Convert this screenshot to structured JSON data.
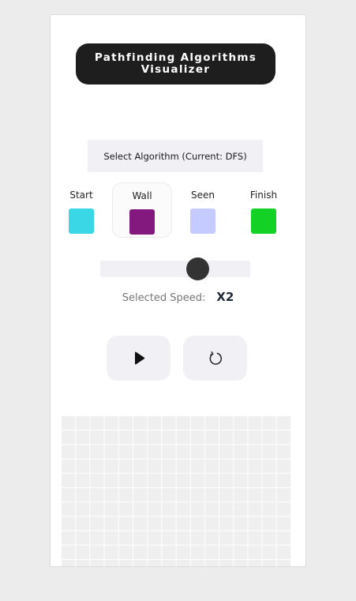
{
  "header": {
    "title_line1": "Pathfinding Algorithms",
    "title_line2": "Visualizer"
  },
  "algorithm": {
    "button_label": "Select Algorithm (Current: DFS)"
  },
  "legend": {
    "items": [
      {
        "label": "Start",
        "color": "#3ad8e6"
      },
      {
        "label": "Wall",
        "color": "#83197f"
      },
      {
        "label": "Seen",
        "color": "#c5cbff"
      },
      {
        "label": "Finish",
        "color": "#13d225"
      }
    ],
    "selected": "Wall"
  },
  "speed": {
    "label": "Selected Speed:",
    "value_text": "X2",
    "slider_level": 0.68
  },
  "controls": {
    "play_icon": "play-icon",
    "reset_icon": "reset-icon"
  },
  "grid": {
    "cell_color": "#efefef",
    "line_color": "#ffffff"
  }
}
